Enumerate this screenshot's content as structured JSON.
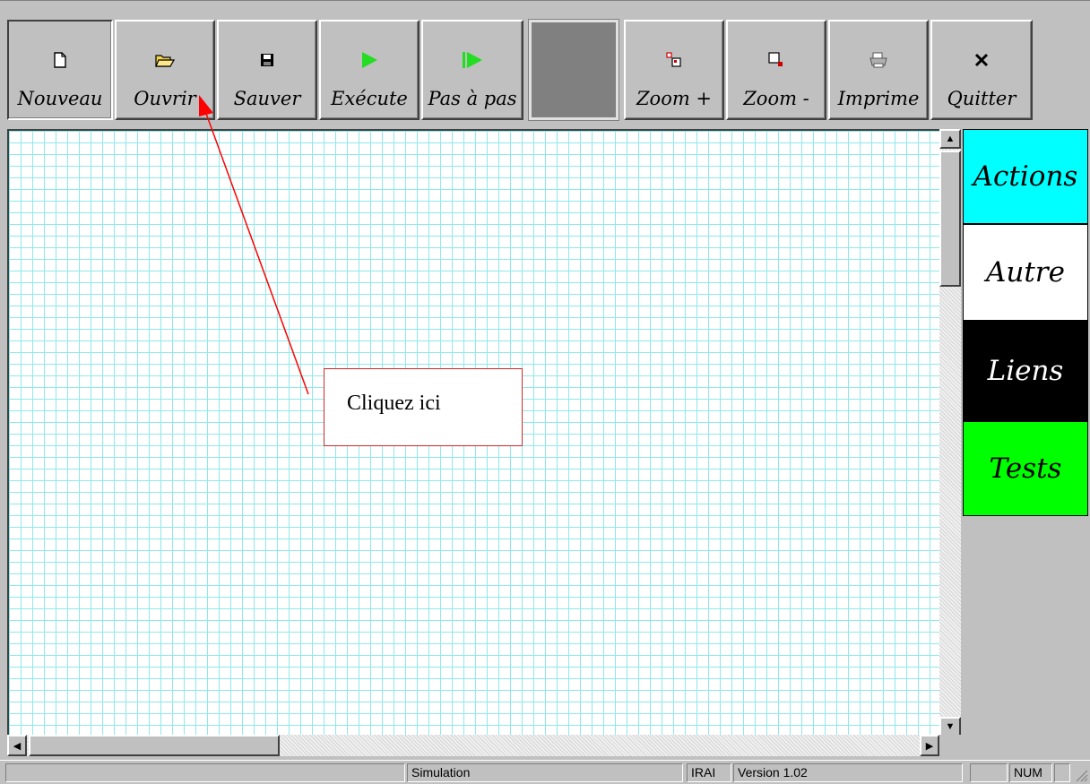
{
  "toolbar": {
    "buttons": [
      {
        "label": "Nouveau",
        "icon": "new-document-icon"
      },
      {
        "label": "Ouvrir",
        "icon": "open-folder-icon"
      },
      {
        "label": "Sauver",
        "icon": "save-disk-icon"
      },
      {
        "label": "Exécute",
        "icon": "play-icon"
      },
      {
        "label": "Pas à pas",
        "icon": "step-play-icon"
      },
      {
        "label": "Zoom +",
        "icon": "zoom-in-icon"
      },
      {
        "label": "Zoom -",
        "icon": "zoom-out-icon"
      },
      {
        "label": "Imprime",
        "icon": "printer-icon"
      },
      {
        "label": "Quitter",
        "icon": "close-x-icon"
      }
    ],
    "swatch_color": "#808080"
  },
  "palette": {
    "items": [
      {
        "label": "Actions",
        "bg": "#00ffff",
        "fg": "#000000"
      },
      {
        "label": "Autre",
        "bg": "#ffffff",
        "fg": "#000000"
      },
      {
        "label": "Liens",
        "bg": "#000000",
        "fg": "#ffffff"
      },
      {
        "label": "Tests",
        "bg": "#00ff00",
        "fg": "#000000"
      }
    ]
  },
  "annotation": {
    "text": "Cliquez ici",
    "color": "#ff0000"
  },
  "statusbar": {
    "mode": "Simulation",
    "app": "IRAI",
    "version": "Version 1.02",
    "num": "NUM"
  },
  "colors": {
    "grid_line": "#8fe8ea",
    "canvas_bg": "#ffffff",
    "chrome": "#c0c0c0"
  }
}
